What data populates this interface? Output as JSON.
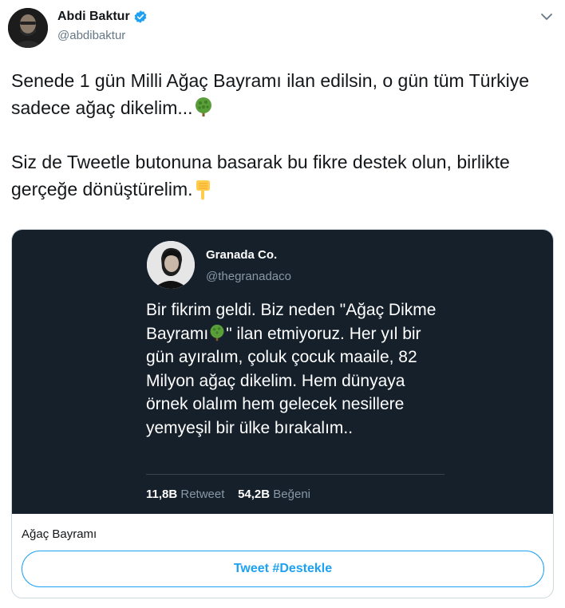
{
  "author": {
    "display_name": "Abdi Baktur",
    "handle": "@abdibaktur",
    "verified": true,
    "avatar_icon": "user-avatar"
  },
  "tweet": {
    "paragraph_1": "Senede 1 gün Milli Ağaç Bayramı ilan edilsin, o gün tüm Türkiye sadece ağaç dikelim...",
    "paragraph_1_emoji": "deciduous-tree-emoji",
    "paragraph_2": "Siz de Tweetle butonuna basarak bu fikre destek olun, birlikte gerçeğe dönüştürelim.",
    "paragraph_2_emoji": "backhand-index-pointing-down-emoji"
  },
  "card": {
    "embedded_tweet": {
      "display_name": "Granada Co.",
      "handle": "@thegranadaco",
      "text_part_1": "Bir fikrim geldi. Biz neden \"Ağaç Dikme Bayramı",
      "text_part_2": "\" ilan etmiyoruz. Her yıl bir gün ayıralım, çoluk çocuk maaile, 82 Milyon ağaç dikelim. Hem dünyaya örnek olalım hem gelecek nesillere yemyeşil bir ülke bırakalım..",
      "retweet_count": "11,8B",
      "retweet_label": "Retweet",
      "like_count": "54,2B",
      "like_label": "Beğeni"
    },
    "title": "Ağaç Bayramı",
    "button_label": "Tweet #Destekle"
  },
  "colors": {
    "accent": "#1da1f2",
    "card_dark_bg": "#15202b",
    "secondary_text": "#657786"
  }
}
